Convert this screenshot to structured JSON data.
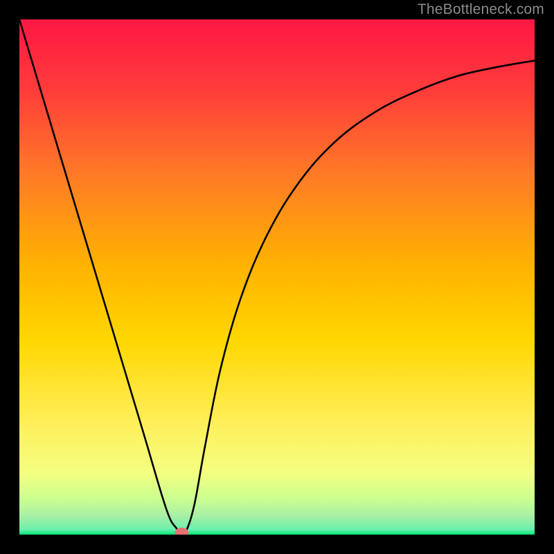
{
  "watermark": "TheBottleneck.com",
  "chart_data": {
    "type": "line",
    "title": "",
    "xlabel": "",
    "ylabel": "",
    "xlim": [
      0,
      1
    ],
    "ylim": [
      0,
      1
    ],
    "background_gradient": {
      "top": "#FF1744",
      "upper_mid": "#FF7A26",
      "mid": "#FFCC00",
      "lower_mid": "#FFEE58",
      "near_bottom": "#E8FF8C",
      "bottom": "#00E676"
    },
    "series": [
      {
        "name": "bottleneck-curve",
        "x": [
          0.0,
          0.06,
          0.12,
          0.18,
          0.24,
          0.285,
          0.305,
          0.315,
          0.325,
          0.34,
          0.36,
          0.39,
          0.43,
          0.48,
          0.54,
          0.61,
          0.69,
          0.77,
          0.85,
          0.93,
          1.0
        ],
        "y": [
          1.0,
          0.8,
          0.6,
          0.4,
          0.2,
          0.05,
          0.012,
          0.004,
          0.01,
          0.06,
          0.17,
          0.32,
          0.46,
          0.58,
          0.68,
          0.76,
          0.82,
          0.86,
          0.89,
          0.908,
          0.92
        ]
      }
    ],
    "marker": {
      "name": "min-point",
      "x": 0.315,
      "y": 0.004,
      "color": "#E57373"
    }
  }
}
